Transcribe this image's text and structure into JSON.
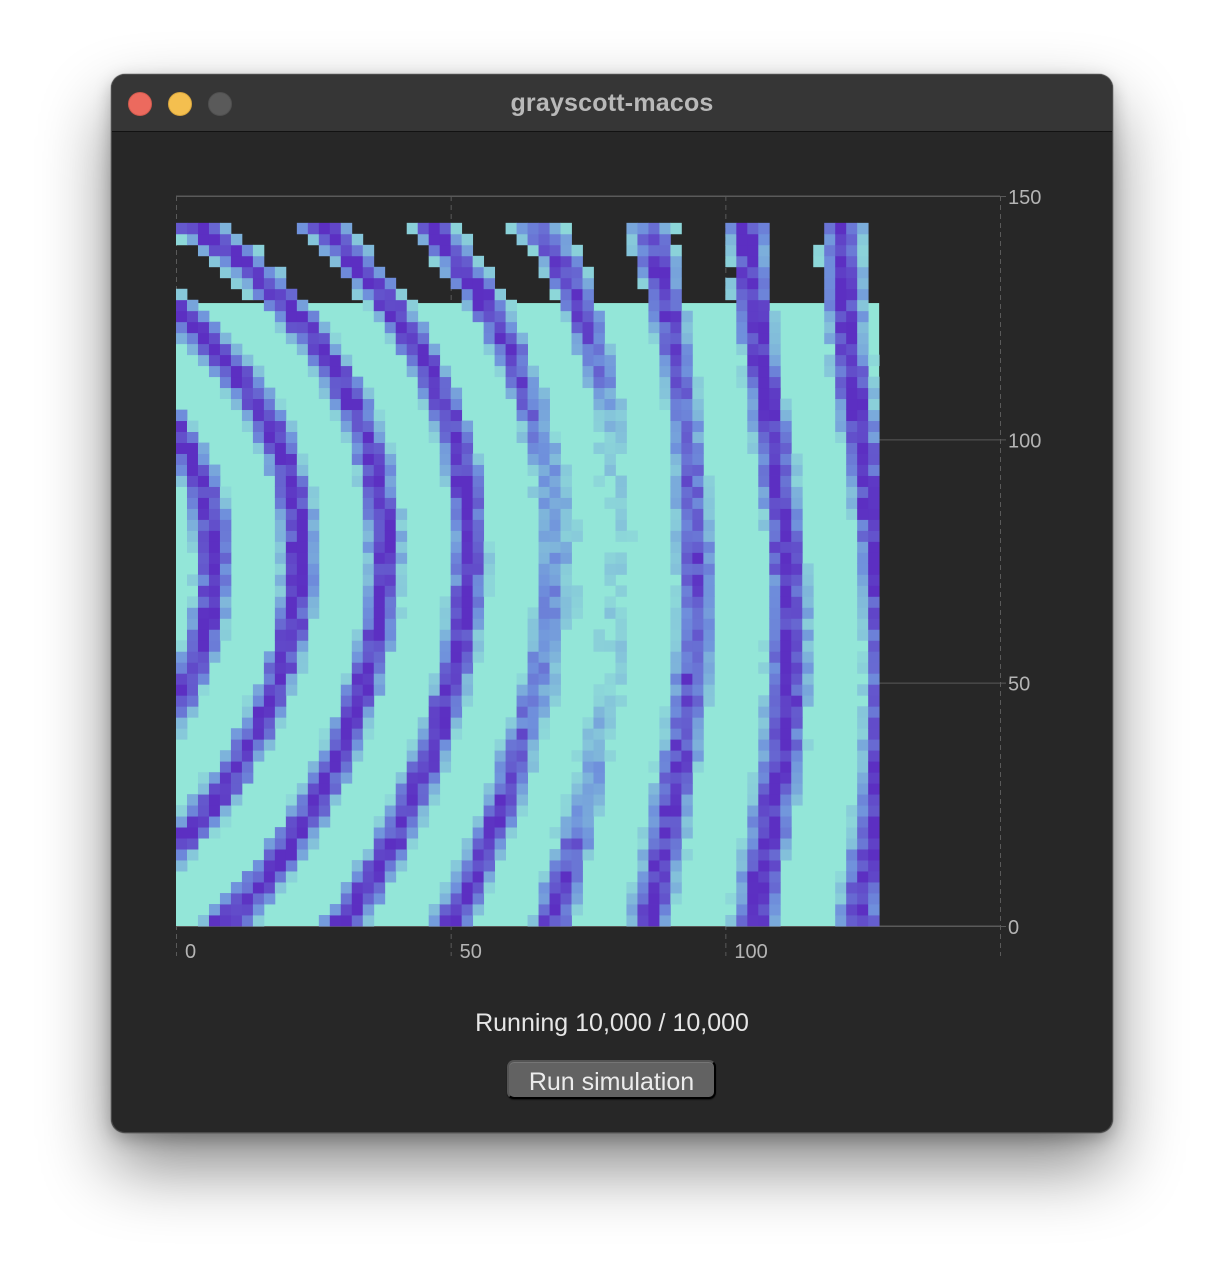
{
  "window": {
    "title": "grayscott-macos",
    "controls": {
      "close_color": "#ec6a5e",
      "minimize_color": "#f4bf4f",
      "zoom_color": "#5a5a5a"
    }
  },
  "colors": {
    "background": "#272727",
    "grid": "#5a5a5a",
    "tick_label": "#b4b4b4",
    "colormap_low": "#97f0d8",
    "colormap_mid": "#6f90dc",
    "colormap_high": "#5c2fc2"
  },
  "status": {
    "text": "Running 10,000 / 10,000"
  },
  "controls": {
    "run_button_label": "Run simulation"
  },
  "chart_data": {
    "type": "heatmap",
    "title": "",
    "xlabel": "",
    "ylabel": "",
    "grid_size": [
      128,
      128
    ],
    "xlim": [
      0,
      150
    ],
    "ylim": [
      0,
      150
    ],
    "x_ticks": [
      0,
      50,
      100
    ],
    "y_ticks": [
      0,
      50,
      100,
      150
    ],
    "x_tick_labels": [
      "0",
      "50",
      "100"
    ],
    "y_tick_labels": [
      "0",
      "50",
      "100",
      "150"
    ],
    "y_axis_side": "right",
    "grid": true,
    "colormap": [
      "#97f0d8",
      "#6f90dc",
      "#5c2fc2"
    ],
    "pattern": "labyrinthine stripes (Gray-Scott reaction-diffusion) after 10,000 steps"
  }
}
